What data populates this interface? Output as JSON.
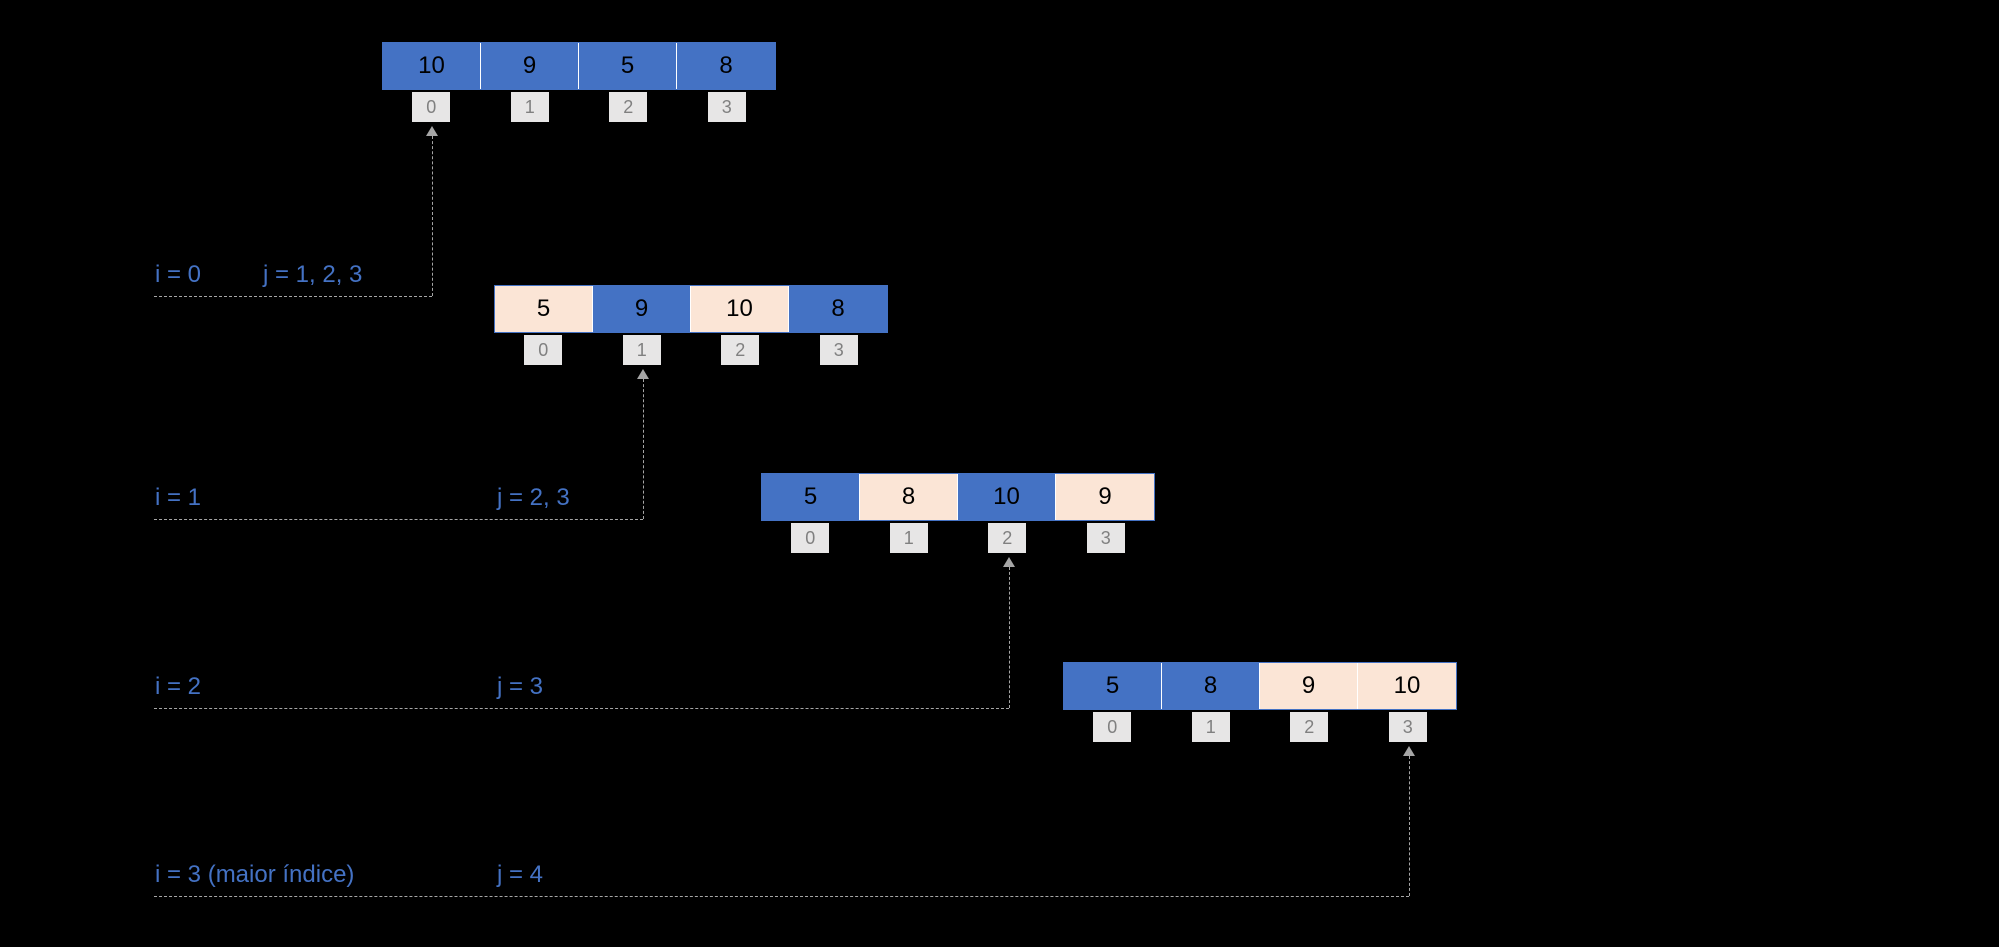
{
  "arrays": {
    "a0": {
      "cells": [
        {
          "v": "10",
          "c": "blue"
        },
        {
          "v": "9",
          "c": "blue"
        },
        {
          "v": "5",
          "c": "blue"
        },
        {
          "v": "8",
          "c": "blue"
        }
      ],
      "idx": [
        "0",
        "1",
        "2",
        "3"
      ]
    },
    "a1": {
      "cells": [
        {
          "v": "5",
          "c": "cream"
        },
        {
          "v": "9",
          "c": "blue"
        },
        {
          "v": "10",
          "c": "cream"
        },
        {
          "v": "8",
          "c": "blue"
        }
      ],
      "idx": [
        "0",
        "1",
        "2",
        "3"
      ]
    },
    "a2": {
      "cells": [
        {
          "v": "5",
          "c": "blue"
        },
        {
          "v": "8",
          "c": "cream"
        },
        {
          "v": "10",
          "c": "blue"
        },
        {
          "v": "9",
          "c": "cream"
        }
      ],
      "idx": [
        "0",
        "1",
        "2",
        "3"
      ]
    },
    "a3": {
      "cells": [
        {
          "v": "5",
          "c": "blue"
        },
        {
          "v": "8",
          "c": "blue"
        },
        {
          "v": "9",
          "c": "cream"
        },
        {
          "v": "10",
          "c": "cream"
        }
      ],
      "idx": [
        "0",
        "1",
        "2",
        "3"
      ]
    }
  },
  "labels": {
    "i0": "i = 0",
    "j0": "j = 1, 2, 3",
    "i1": "i = 1",
    "j1": "j = 2, 3",
    "i2": "i = 2",
    "j2": "j = 3",
    "i3": "i = 3 (maior índice)",
    "j3": "j = 4"
  }
}
